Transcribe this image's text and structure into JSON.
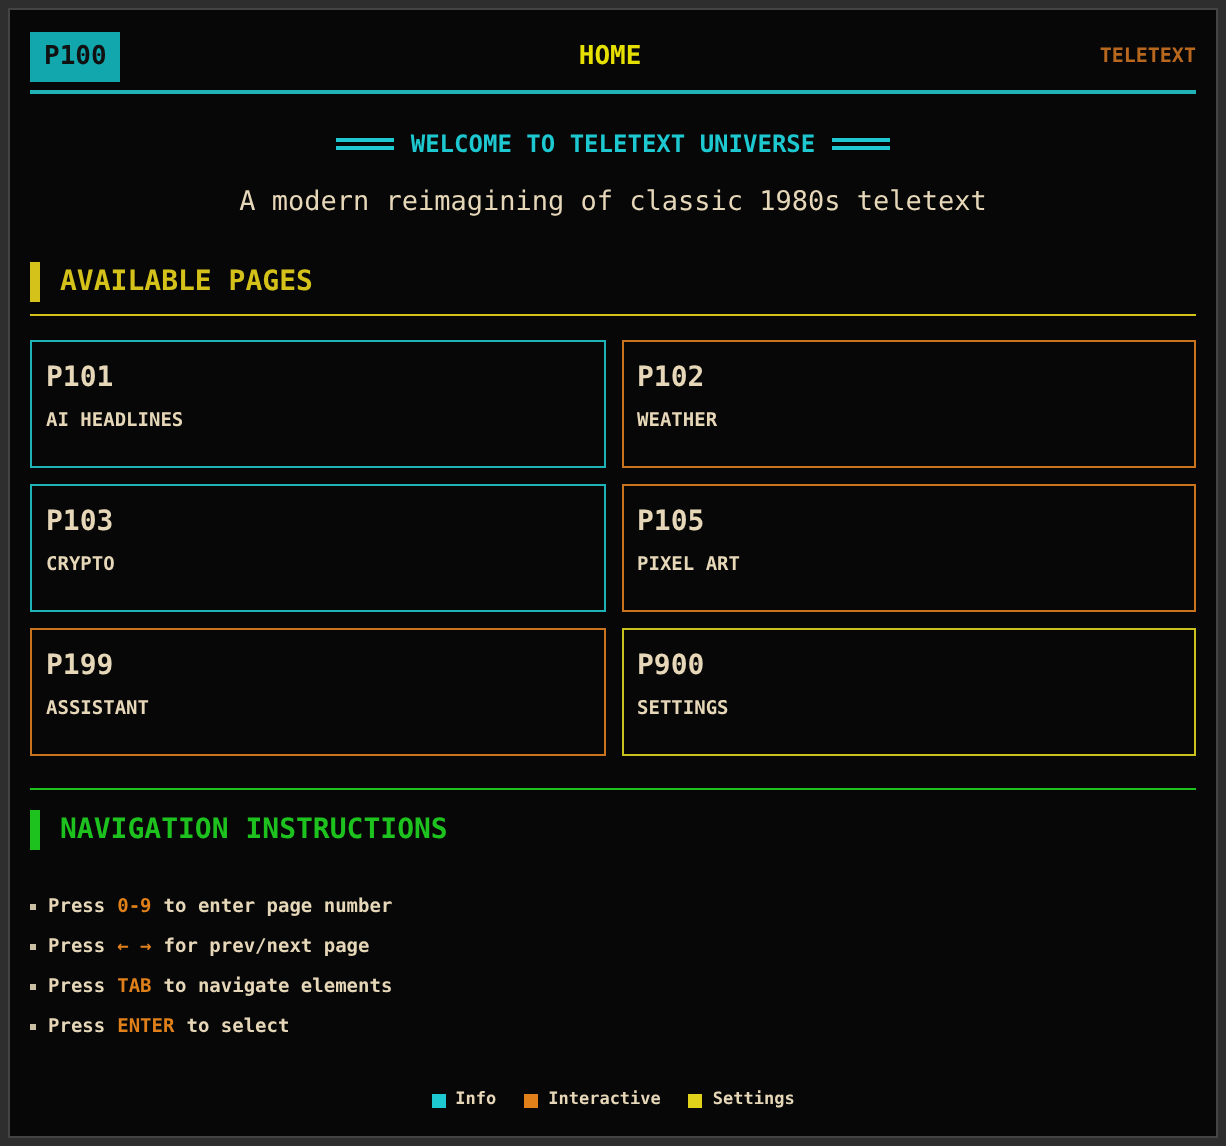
{
  "header": {
    "page": "P100",
    "title": "HOME",
    "brand": "TELETEXT"
  },
  "welcome": {
    "title": "WELCOME TO TELETEXT UNIVERSE",
    "subtitle": "A modern reimagining of classic 1980s teletext"
  },
  "pages_section": {
    "heading": "AVAILABLE PAGES",
    "color": "#d4c21a"
  },
  "pages": [
    {
      "number": "P101",
      "label": "AI HEADLINES",
      "color": "#1fb3b8"
    },
    {
      "number": "P102",
      "label": "WEATHER",
      "color": "#c9731e"
    },
    {
      "number": "P103",
      "label": "CRYPTO",
      "color": "#1fb3b8"
    },
    {
      "number": "P105",
      "label": "PIXEL ART",
      "color": "#c9731e"
    },
    {
      "number": "P199",
      "label": "ASSISTANT",
      "color": "#c9731e"
    },
    {
      "number": "P900",
      "label": "SETTINGS",
      "color": "#c9c21e"
    }
  ],
  "nav_section": {
    "heading": "NAVIGATION INSTRUCTIONS",
    "color": "#1ec21e"
  },
  "instructions": [
    {
      "before": "Press",
      "key": "0-9",
      "after": "to enter page number"
    },
    {
      "before": "Press",
      "key": "← →",
      "after": "for prev/next page"
    },
    {
      "before": "Press",
      "key": "TAB",
      "after": "to navigate elements"
    },
    {
      "before": "Press",
      "key": "ENTER",
      "after": "to select"
    }
  ],
  "legend": [
    {
      "label": "Info",
      "color": "#1ec8d0"
    },
    {
      "label": "Interactive",
      "color": "#e0801a"
    },
    {
      "label": "Settings",
      "color": "#e0d21a"
    }
  ]
}
